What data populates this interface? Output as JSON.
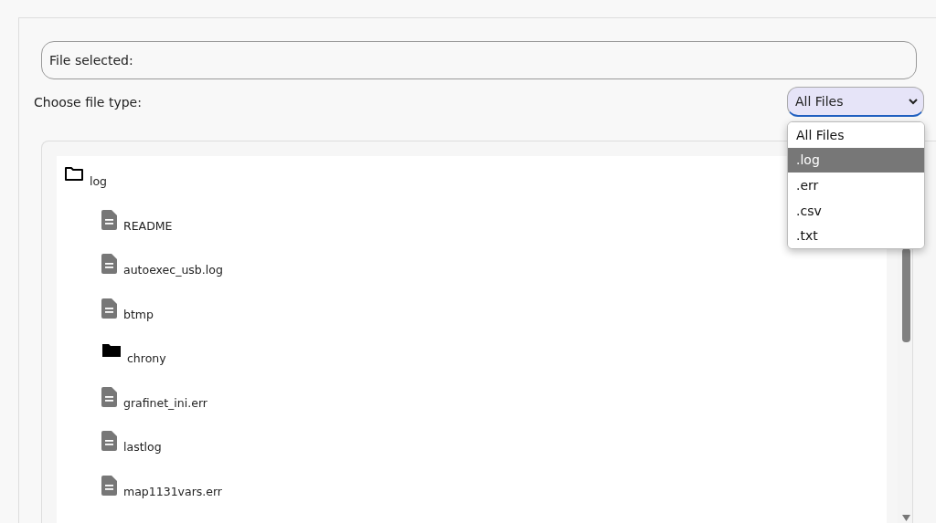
{
  "file_selected": {
    "label": "File selected:"
  },
  "file_type": {
    "label": "Choose file type:",
    "value": "All Files",
    "open": true,
    "options": [
      {
        "label": "All Files",
        "highlighted": false
      },
      {
        "label": ".log",
        "highlighted": true
      },
      {
        "label": ".err",
        "highlighted": false
      },
      {
        "label": ".csv",
        "highlighted": false
      },
      {
        "label": ".txt",
        "highlighted": false
      }
    ]
  },
  "tree": {
    "name": "log",
    "kind": "folder",
    "expanded": true,
    "children": [
      {
        "name": "README",
        "kind": "file"
      },
      {
        "name": "autoexec_usb.log",
        "kind": "file"
      },
      {
        "name": "btmp",
        "kind": "file"
      },
      {
        "name": "chrony",
        "kind": "folder",
        "expanded": false
      },
      {
        "name": "grafinet_ini.err",
        "kind": "file"
      },
      {
        "name": "lastlog",
        "kind": "file"
      },
      {
        "name": "map1131vars.err",
        "kind": "file"
      }
    ]
  }
}
